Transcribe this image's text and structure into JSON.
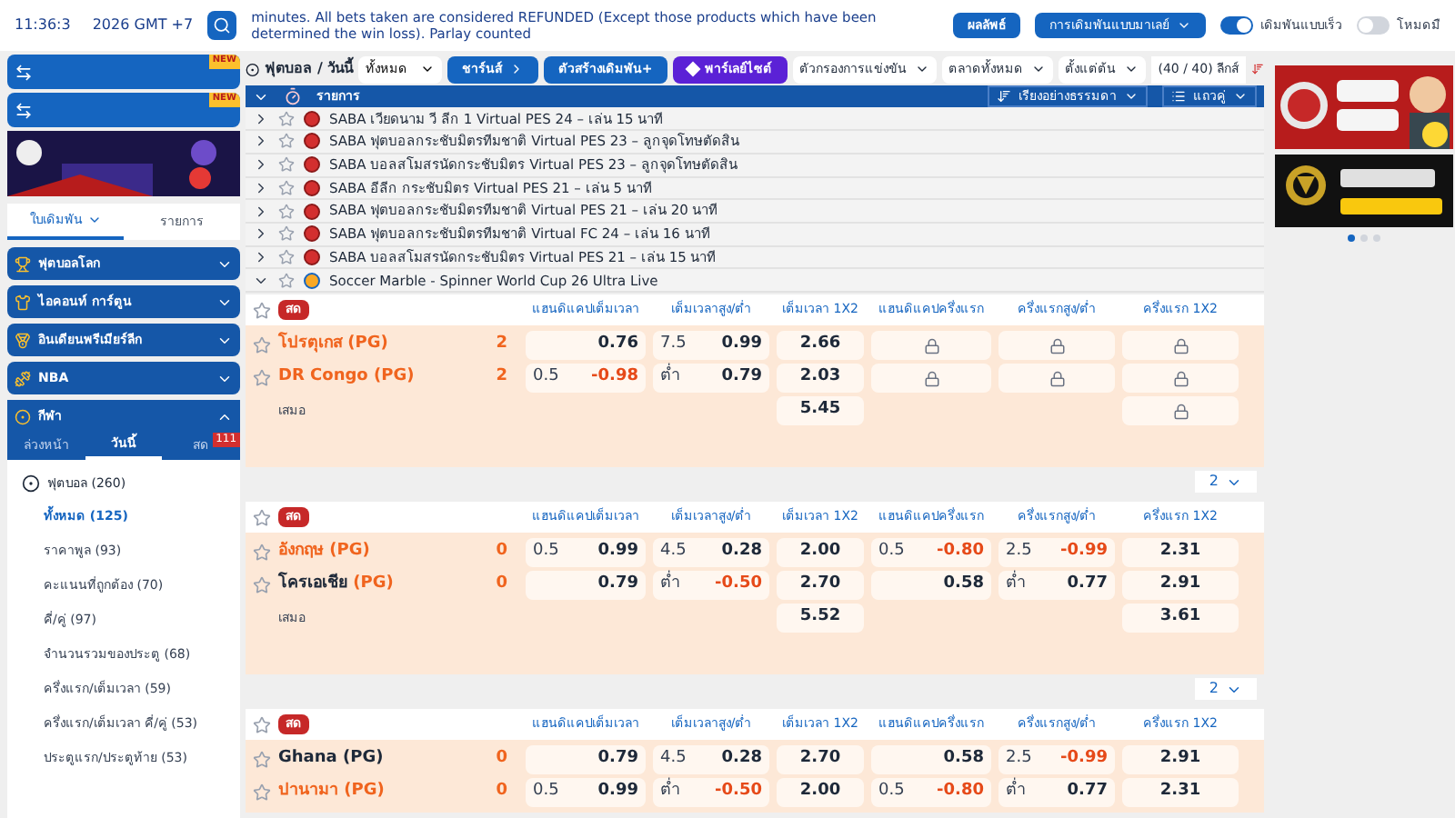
{
  "top_bar": {
    "time": "11:36:3",
    "date_tail": "2026 GMT +7",
    "marquee": "minutes. All bets taken are considered REFUNDED (Except those products which have been determined the win loss). Parlay counted",
    "results_button": "ผลลัพธ์",
    "odds_type": "การเดิมพันแบบมาเลย์",
    "toggles": [
      {
        "label": "เดิมพันแบบเร็ว",
        "on": true
      },
      {
        "label": "โหมดมื",
        "on": false
      }
    ]
  },
  "sidebar": {
    "promo_buttons": [
      {
        "badge": "NEW"
      },
      {
        "badge": "NEW"
      }
    ],
    "tabs": [
      {
        "label": "ใบเดิมพัน",
        "selected": true
      },
      {
        "label": "รายการ",
        "selected": false
      }
    ],
    "categories": [
      {
        "label": "ฟุตบอลโลก",
        "expanded": false
      },
      {
        "label": "ไอคอนท์ การ์ตูน",
        "expanded": false
      },
      {
        "label": "อินเดียนพรีเมียร์ลีก",
        "expanded": false
      },
      {
        "label": "NBA",
        "expanded": false
      },
      {
        "label": "กีฬา",
        "expanded": true
      }
    ],
    "sport_tabs": [
      {
        "label": "ล่วงหน้า",
        "selected": false
      },
      {
        "label": "วันนี้",
        "selected": true
      },
      {
        "label": "สด",
        "selected": false,
        "badge": "111"
      }
    ],
    "sport": "ฟุตบอล (260)",
    "markets": [
      {
        "label": "ทั้งหมด (125)",
        "selected": true
      },
      {
        "label": "ราคาพูล (93)",
        "selected": false
      },
      {
        "label": "คะแนนที่ถูกต้อง (70)",
        "selected": false
      },
      {
        "label": "คี่/คู่ (97)",
        "selected": false
      },
      {
        "label": "จำนวนรวมของประตู (68)",
        "selected": false
      },
      {
        "label": "ครึ่งแรก/เต็มเวลา (59)",
        "selected": false
      },
      {
        "label": "ครึ่งแรก/เต็มเวลา คี่/คู่ (53)",
        "selected": false
      },
      {
        "label": "ประตูแรก/ประตูท้าย (53)",
        "selected": false
      }
    ]
  },
  "toolbar": {
    "title": "ฟุตบอล / วันนี้",
    "filter": "ทั้งหมด",
    "buttons": [
      "ชาร์นส์",
      "ตัวสร้างเดิมพัน+",
      "พาร์เลย์ไซต์"
    ],
    "dropdowns": [
      "ตัวกรองการแข่งขัน",
      "ตลาดทั้งหมด",
      "ตั้งแต่ต้น"
    ],
    "league_count": "(40 / 40) ลีกส์"
  },
  "list_header": {
    "title": "รายการ",
    "sort": "เรียงอย่างธรรมดา",
    "view": "แถวคู่"
  },
  "leagues": [
    {
      "name": "SABA เวียดนาม วี ลีก 1 Virtual PES 24 – เล่น 15 นาที",
      "kind": "virtual",
      "expanded": false
    },
    {
      "name": "SABA ฟุตบอลกระชับมิตรทีมชาติ Virtual PES 23 – ลูกจุดโทษตัดสิน",
      "kind": "virtual",
      "expanded": false
    },
    {
      "name": "SABA บอลสโมสรนัดกระชับมิตร Virtual PES 23 – ลูกจุดโทษตัดสิน",
      "kind": "virtual",
      "expanded": false
    },
    {
      "name": "SABA อีลีก กระชับมิตร Virtual PES 21 – เล่น 5 นาที",
      "kind": "virtual",
      "expanded": false
    },
    {
      "name": "SABA ฟุตบอลกระชับมิตรทีมชาติ Virtual PES 21 – เล่น 20 นาที",
      "kind": "virtual",
      "expanded": false
    },
    {
      "name": "SABA ฟุตบอลกระชับมิตรทีมชาติ Virtual FC 24 – เล่น 16 นาที",
      "kind": "virtual",
      "expanded": false
    },
    {
      "name": "SABA บอลสโมสรนัดกระชับมิตร Virtual PES 21 – เล่น 15 นาที",
      "kind": "virtual",
      "expanded": false
    },
    {
      "name": "Soccer Marble - Spinner World Cup 26 Ultra Live",
      "kind": "marble",
      "expanded": true
    }
  ],
  "matches": [
    {
      "badge": "สด",
      "more": "2",
      "columns": [
        "แฮนดิแคปเต็มเวลา",
        "เต็มเวลาสูง/ต่ำ",
        "เต็มเวลา 1X2",
        "แฮนดิแคปครึ่งแรก",
        "ครึ่งแรกสูง/ต่ำ",
        "ครึ่งแรก 1X2"
      ],
      "teams": [
        {
          "name": "โปรตุเกส",
          "tag": "(PG)",
          "highlighted": true,
          "tag_highlighted": true,
          "score": "2",
          "hdp": {
            "odds": "0.76",
            "negative": false
          },
          "ou": {
            "line": "7.5",
            "odds": "0.99",
            "negative": false
          },
          "x12": "2.66",
          "h_hdp": {
            "locked": true
          },
          "h_ou": {
            "locked": true
          },
          "h_x12": {
            "locked": true
          }
        },
        {
          "name": "DR Congo",
          "tag": "(PG)",
          "highlighted": true,
          "tag_highlighted": true,
          "score": "2",
          "hdp": {
            "line": "0.5",
            "odds": "-0.98",
            "negative": true
          },
          "ou": {
            "line": "ต่ำ",
            "odds": "0.79",
            "negative": false
          },
          "x12": "2.03",
          "h_hdp": {
            "locked": true
          },
          "h_ou": {
            "locked": true
          },
          "h_x12": {
            "locked": true
          }
        }
      ],
      "draw": {
        "label": "เสมอ",
        "x12": "5.45",
        "h_x12": {
          "locked": true
        }
      }
    },
    {
      "badge": "สด",
      "more": "2",
      "columns": [
        "แฮนดิแคปเต็มเวลา",
        "เต็มเวลาสูง/ต่ำ",
        "เต็มเวลา 1X2",
        "แฮนดิแคปครึ่งแรก",
        "ครึ่งแรกสูง/ต่ำ",
        "ครึ่งแรก 1X2"
      ],
      "teams": [
        {
          "name": "อังกฤษ",
          "tag": "(PG)",
          "highlighted": true,
          "tag_highlighted": true,
          "score": "0",
          "hdp": {
            "line": "0.5",
            "odds": "0.99",
            "negative": false
          },
          "ou": {
            "line": "4.5",
            "odds": "0.28",
            "negative": false
          },
          "x12": "2.00",
          "h_hdp": {
            "line": "0.5",
            "odds": "-0.80",
            "negative": true
          },
          "h_ou": {
            "line": "2.5",
            "odds": "-0.99",
            "negative": true
          },
          "h_x12": {
            "value": "2.31"
          }
        },
        {
          "name": "โครเอเชีย",
          "tag": "(PG)",
          "highlighted": false,
          "tag_highlighted": true,
          "score": "0",
          "hdp": {
            "odds": "0.79",
            "negative": false
          },
          "ou": {
            "line": "ต่ำ",
            "odds": "-0.50",
            "negative": true
          },
          "x12": "2.70",
          "h_hdp": {
            "odds": "0.58",
            "negative": false
          },
          "h_ou": {
            "line": "ต่ำ",
            "odds": "0.77",
            "negative": false
          },
          "h_x12": {
            "value": "2.91"
          }
        }
      ],
      "draw": {
        "label": "เสมอ",
        "x12": "5.52",
        "h_x12": {
          "value": "3.61"
        }
      }
    },
    {
      "badge": "สด",
      "columns": [
        "แฮนดิแคปเต็มเวลา",
        "เต็มเวลาสูง/ต่ำ",
        "เต็มเวลา 1X2",
        "แฮนดิแคปครึ่งแรก",
        "ครึ่งแรกสูง/ต่ำ",
        "ครึ่งแรก 1X2"
      ],
      "teams": [
        {
          "name": "Ghana",
          "tag": "(PG)",
          "highlighted": false,
          "tag_highlighted": false,
          "score": "0",
          "hdp": {
            "odds": "0.79",
            "negative": false
          },
          "ou": {
            "line": "4.5",
            "odds": "0.28",
            "negative": false
          },
          "x12": "2.70",
          "h_hdp": {
            "odds": "0.58",
            "negative": false
          },
          "h_ou": {
            "line": "2.5",
            "odds": "-0.99",
            "negative": true
          },
          "h_x12": {
            "value": "2.91"
          }
        },
        {
          "name": "ปานามา",
          "tag": "(PG)",
          "highlighted": true,
          "tag_highlighted": true,
          "score": "0",
          "hdp": {
            "line": "0.5",
            "odds": "0.99",
            "negative": false
          },
          "ou": {
            "line": "ต่ำ",
            "odds": "-0.50",
            "negative": true
          },
          "x12": "2.00",
          "h_hdp": {
            "line": "0.5",
            "odds": "-0.80",
            "negative": true
          },
          "h_ou": {
            "line": "ต่ำ",
            "odds": "0.77",
            "negative": false
          },
          "h_x12": {
            "value": "2.31"
          }
        }
      ]
    }
  ],
  "ads": {
    "dots": [
      {
        "selected": true
      },
      {
        "selected": false
      },
      {
        "selected": false
      }
    ]
  }
}
